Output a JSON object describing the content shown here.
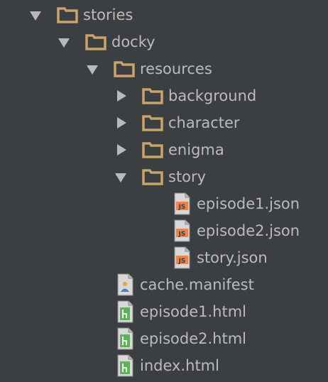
{
  "tree": {
    "stories": {
      "label": "stories",
      "expanded": true,
      "icon": "folder-icon"
    },
    "docky": {
      "label": "docky",
      "expanded": true,
      "icon": "folder-icon"
    },
    "resources": {
      "label": "resources",
      "expanded": true,
      "icon": "folder-icon"
    },
    "background": {
      "label": "background",
      "expanded": false,
      "icon": "folder-icon"
    },
    "character": {
      "label": "character",
      "expanded": false,
      "icon": "folder-icon"
    },
    "enigma": {
      "label": "enigma",
      "expanded": false,
      "icon": "folder-icon"
    },
    "story": {
      "label": "story",
      "expanded": true,
      "icon": "folder-icon"
    },
    "episode1_json": {
      "label": "episode1.json",
      "icon": "json-file-icon",
      "icon_text": "JS"
    },
    "episode2_json": {
      "label": "episode2.json",
      "icon": "json-file-icon",
      "icon_text": "JS"
    },
    "story_json": {
      "label": "story.json",
      "icon": "json-file-icon",
      "icon_text": "JS"
    },
    "cache_manifest": {
      "label": "cache.manifest",
      "icon": "manifest-file-icon"
    },
    "episode1_html": {
      "label": "episode1.html",
      "icon": "html-file-icon"
    },
    "episode2_html": {
      "label": "episode2.html",
      "icon": "html-file-icon"
    },
    "index_html": {
      "label": "index.html",
      "icon": "html-file-icon"
    }
  },
  "colors": {
    "background": "#3c3f41",
    "text": "#bbbbbb",
    "folder": "#c8a46b",
    "json_icon": "#e8844c",
    "html_icon": "#5fb15a",
    "arrow": "#b9b9b9"
  }
}
